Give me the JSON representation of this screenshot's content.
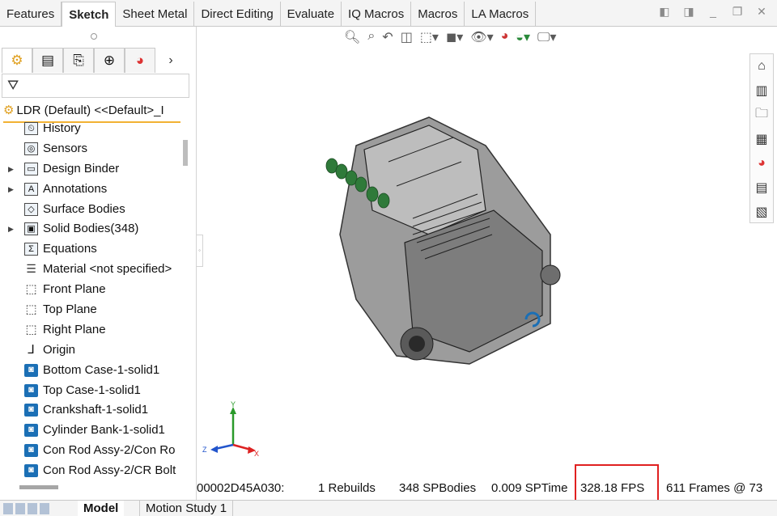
{
  "ribbon": {
    "tabs": [
      "Features",
      "Sketch",
      "Sheet Metal",
      "Direct Editing",
      "Evaluate",
      "IQ Macros",
      "Macros",
      "LA Macros"
    ],
    "active_tab": "Sketch"
  },
  "feature_tree": {
    "root": "LDR (Default) <<Default>_I",
    "items": [
      {
        "label": "History",
        "icon": "history-icon",
        "expandable": false
      },
      {
        "label": "Sensors",
        "icon": "sensors-icon",
        "expandable": false
      },
      {
        "label": "Design Binder",
        "icon": "design-binder-icon",
        "expandable": true
      },
      {
        "label": "Annotations",
        "icon": "annotations-icon",
        "expandable": true
      },
      {
        "label": "Surface Bodies",
        "icon": "surface-bodies-icon",
        "expandable": false
      },
      {
        "label": "Solid Bodies(348)",
        "icon": "solid-bodies-icon",
        "expandable": true
      },
      {
        "label": "Equations",
        "icon": "equations-icon",
        "expandable": false
      },
      {
        "label": "Material <not specified>",
        "icon": "material-icon",
        "expandable": false
      },
      {
        "label": "Front Plane",
        "icon": "plane-icon",
        "expandable": false
      },
      {
        "label": "Top Plane",
        "icon": "plane-icon",
        "expandable": false
      },
      {
        "label": "Right Plane",
        "icon": "plane-icon",
        "expandable": false
      },
      {
        "label": "Origin",
        "icon": "origin-icon",
        "expandable": false
      },
      {
        "label": "Bottom Case-1-solid1",
        "icon": "solid-body-icon",
        "expandable": false
      },
      {
        "label": "Top Case-1-solid1",
        "icon": "solid-body-icon",
        "expandable": false
      },
      {
        "label": "Crankshaft-1-solid1",
        "icon": "solid-body-icon",
        "expandable": false
      },
      {
        "label": "Cylinder Bank-1-solid1",
        "icon": "solid-body-icon",
        "expandable": false
      },
      {
        "label": "Con Rod Assy-2/Con Ro",
        "icon": "solid-body-icon",
        "expandable": false
      },
      {
        "label": "Con Rod Assy-2/CR Bolt",
        "icon": "solid-body-icon",
        "expandable": false
      }
    ]
  },
  "status_bar": {
    "address": "00002D45A030:",
    "rebuilds": "1 Rebuilds",
    "spbodies": "348 SPBodies",
    "sptime": "0.009 SPTime",
    "fps": "328.18 FPS",
    "frames": "611 Frames @ 73"
  },
  "triad": {
    "y": "Y",
    "z": "Z",
    "x": "X"
  },
  "bottom_tabs": {
    "model": "Model",
    "motion": "Motion Study 1"
  },
  "colors": {
    "highlight_box": "#e02020",
    "tree_underline": "#f2b233",
    "solid_icon": "#1b6fb5"
  }
}
